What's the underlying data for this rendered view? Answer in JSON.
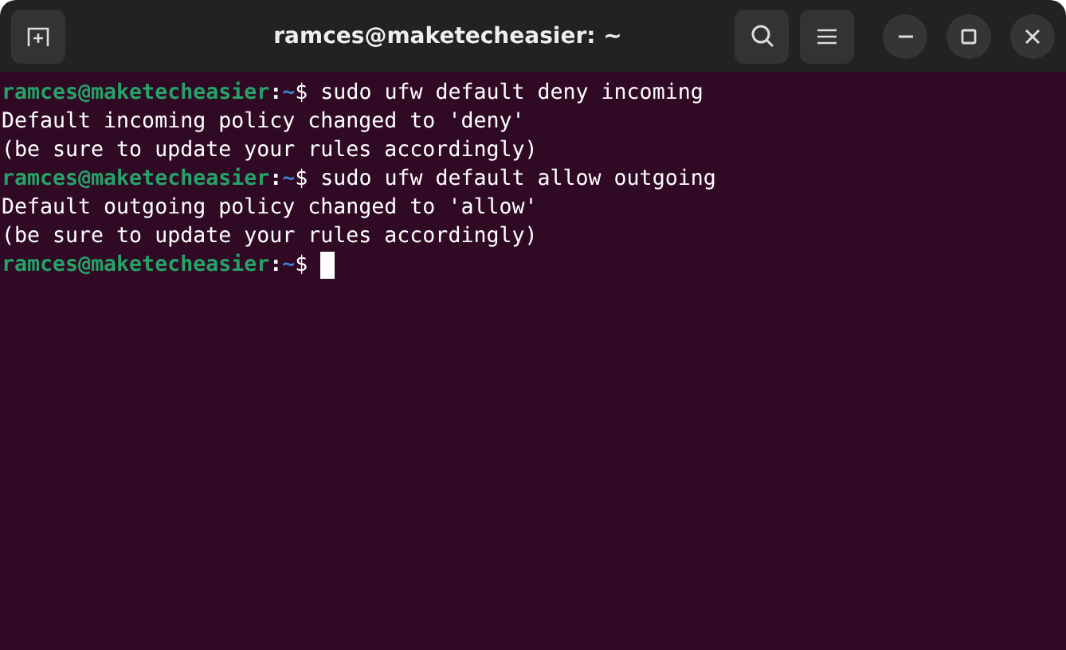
{
  "window": {
    "title": "ramces@maketecheasier: ~"
  },
  "terminal": {
    "lines": [
      {
        "kind": "prompt",
        "prompt": [
          {
            "kind": "user",
            "text": "ramces@maketecheasier"
          },
          {
            "kind": "sep",
            "text": ":"
          },
          {
            "kind": "path",
            "text": "~"
          },
          {
            "kind": "symbol",
            "text": "$"
          }
        ],
        "command": "sudo ufw default deny incoming",
        "cursor": false
      },
      {
        "kind": "output",
        "text": "Default incoming policy changed to 'deny'"
      },
      {
        "kind": "output",
        "text": "(be sure to update your rules accordingly)"
      },
      {
        "kind": "prompt",
        "prompt": [
          {
            "kind": "user",
            "text": "ramces@maketecheasier"
          },
          {
            "kind": "sep",
            "text": ":"
          },
          {
            "kind": "path",
            "text": "~"
          },
          {
            "kind": "symbol",
            "text": "$"
          }
        ],
        "command": "sudo ufw default allow outgoing",
        "cursor": false
      },
      {
        "kind": "output",
        "text": "Default outgoing policy changed to 'allow'"
      },
      {
        "kind": "output",
        "text": "(be sure to update your rules accordingly)"
      },
      {
        "kind": "prompt",
        "prompt": [
          {
            "kind": "user",
            "text": "ramces@maketecheasier"
          },
          {
            "kind": "sep",
            "text": ":"
          },
          {
            "kind": "path",
            "text": "~"
          },
          {
            "kind": "symbol",
            "text": "$"
          }
        ],
        "cursor": true
      }
    ]
  }
}
